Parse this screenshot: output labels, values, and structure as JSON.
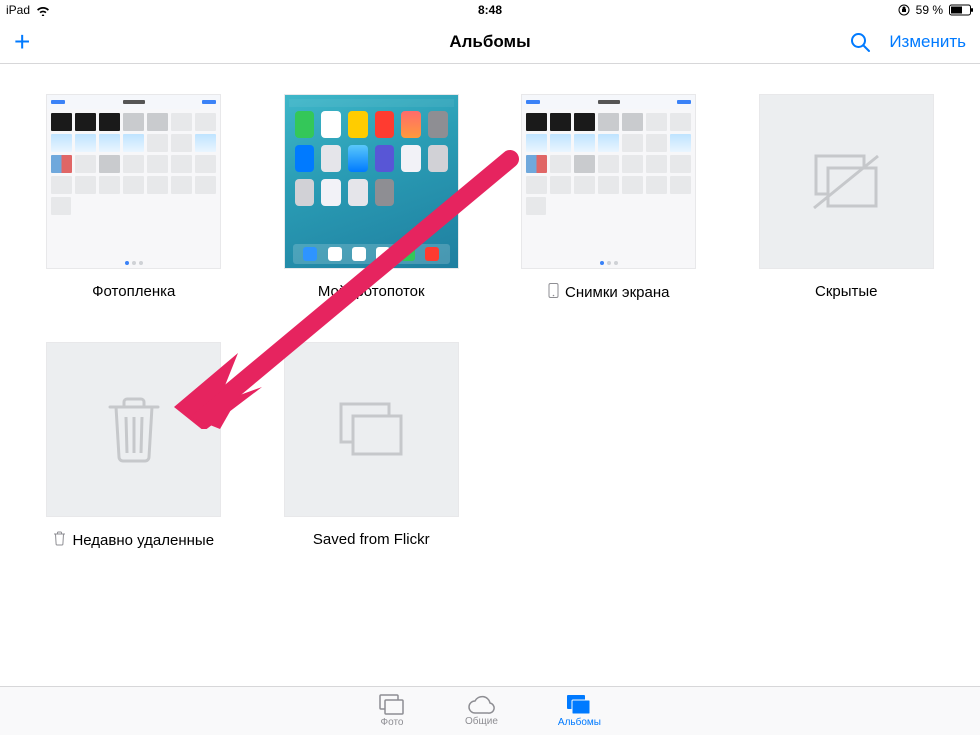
{
  "status": {
    "device": "iPad",
    "time": "8:48",
    "battery_text": "59 %"
  },
  "nav": {
    "title": "Альбомы",
    "edit": "Изменить"
  },
  "albums": [
    {
      "label": "Фотопленка",
      "icon": null,
      "thumb": "grid"
    },
    {
      "label": "Мой фотопоток",
      "icon": null,
      "thumb": "home"
    },
    {
      "label": "Снимки экрана",
      "icon": "phone",
      "thumb": "grid"
    },
    {
      "label": "Скрытые",
      "icon": null,
      "thumb": "hidden"
    },
    {
      "label": "Недавно удаленные",
      "icon": "trash",
      "thumb": "trash"
    },
    {
      "label": "Saved from Flickr",
      "icon": null,
      "thumb": "stack"
    }
  ],
  "tabs": {
    "photos": "Фото",
    "shared": "Общие",
    "albums": "Альбомы"
  }
}
